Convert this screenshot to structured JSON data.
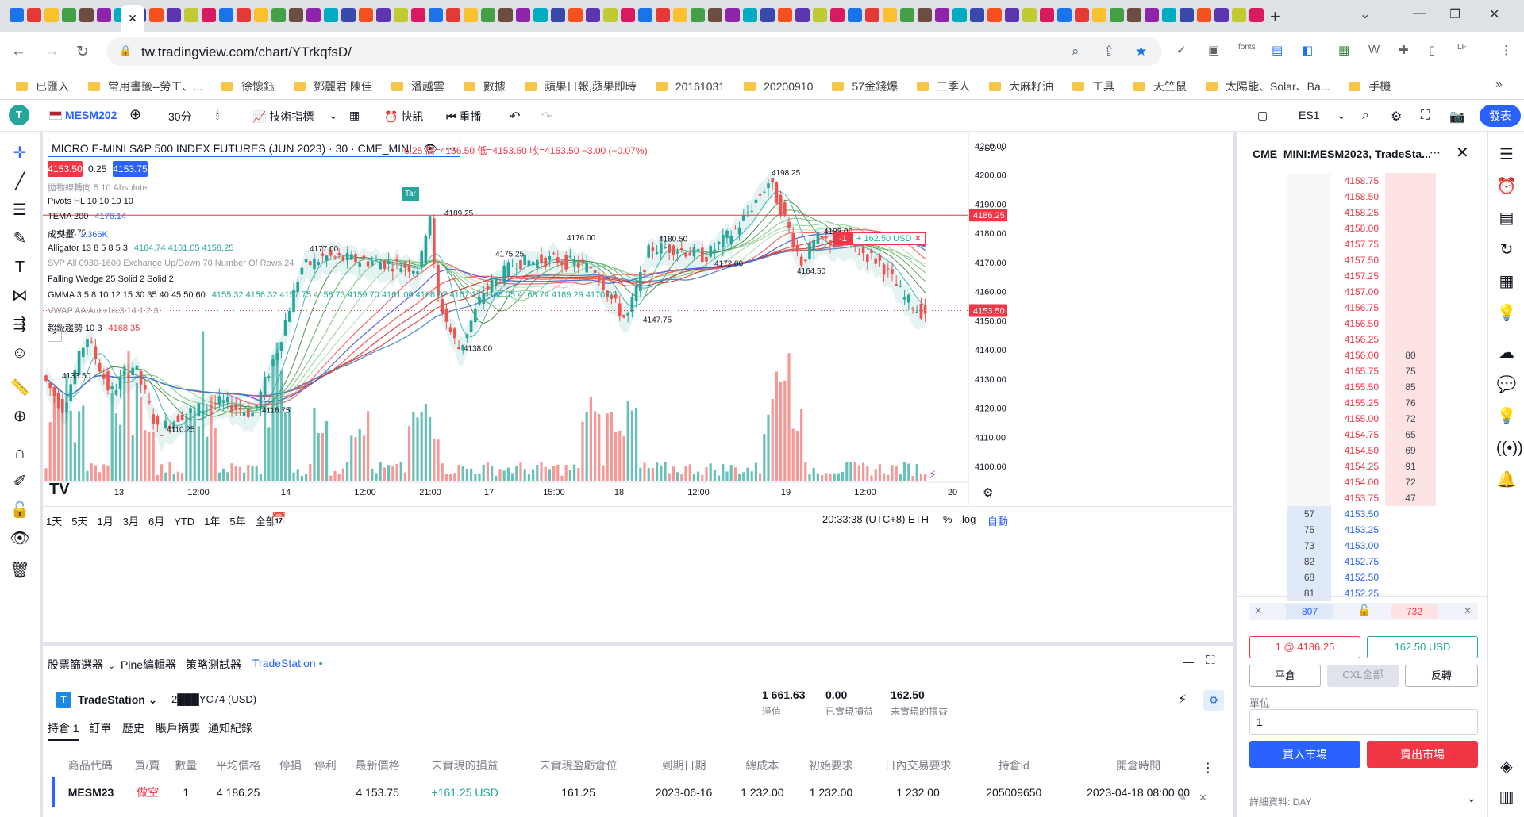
{
  "browser": {
    "url": "tw.tradingview.com/chart/YTrkqfsD/",
    "bookmarks": [
      "已匯入",
      "常用書籤--勞工、...",
      "徐懷鈺",
      "鄧麗君 陳佳",
      "潘越雲",
      "數據",
      "蘋果日報,蘋果即時",
      "20161031",
      "20200910",
      "57金錢爆",
      "三季人",
      "大麻籽油",
      "工具",
      "天竺鼠",
      "太陽能、Solar、Ba...",
      "手機"
    ]
  },
  "toolbar": {
    "symbol": "MESM202",
    "interval": "30分",
    "indicators": "技術指標",
    "alert": "快訊",
    "replay": "重播",
    "layout_name": "ES1",
    "publish": "發表"
  },
  "chart": {
    "legend_title": "MICRO E-MINI S&P 500 INDEX FUTURES (JUN 2023) · 30 · CME_MINI",
    "ohlc": "6.25 高=4156.50 低=4153.50 收=4153.50 −3.00 (−0.07%)",
    "bid_box": "4153.50",
    "spread": "0.25",
    "ask_box": "4153.75",
    "indicators": [
      {
        "name": "拋物線轉向 5 10 Absolute",
        "value": "",
        "muted": true
      },
      {
        "name": "Pivots HL 10 10 10 10",
        "value": ""
      },
      {
        "name": "TEMA 200",
        "value": "4176.14"
      },
      {
        "name": "成交量",
        "value": "1.366K"
      },
      {
        "name": "Alligator 13 8 5 8 5 3",
        "value": "4164.74  4161.05  4158.25"
      },
      {
        "name": "SVP All 0930-1600 Exchange Up/Down 70 Number Of Rows 24",
        "value": "",
        "muted": true
      },
      {
        "name": "Falling Wedge 25 Solid 2 Solid 2",
        "value": ""
      },
      {
        "name": "GMMA 3 5 8 10 12 15 30 35 40 45 50 60",
        "value": "4155.32 4156.32 4157.75 4158.73 4159.70 4161.06 4166.07 4167.17 4168.05 4168.74 4169.29 4170.02"
      },
      {
        "name": "VWAP AA Auto hlc3 14 1 2 3",
        "value": "",
        "muted": true
      },
      {
        "name": "超級趨勢 10 3",
        "value": "4168.35"
      }
    ],
    "currency": "USD",
    "price_axis": [
      "4210.00",
      "4200.00",
      "4190.00",
      "4180.00",
      "4170.00",
      "4160.00",
      "4150.00",
      "4140.00",
      "4130.00",
      "4120.00",
      "4110.00",
      "4100.00"
    ],
    "price_axis_values": [
      4210,
      4200,
      4190,
      4180,
      4170,
      4160,
      4150,
      4140,
      4130,
      4120,
      4110,
      4100
    ],
    "position_price_label": "4186.25",
    "position_price": 4186.25,
    "last_price_label": "4153.50",
    "last_price": 4153.5,
    "position_qty": "-1",
    "position_pnl": "+ 162.50 USD",
    "time_axis": [
      "13",
      "12:00",
      "14",
      "12:00",
      "21:00",
      "17",
      "15:00",
      "18",
      "12:00",
      "19",
      "12:00",
      "20"
    ],
    "pivot_labels": [
      {
        "text": "4177.75",
        "price": 4177.75
      },
      {
        "text": "4133.50",
        "price": 4133.5
      },
      {
        "text": "4110.25",
        "price": 4110.25
      },
      {
        "text": "4177.00",
        "price": 4177.0
      },
      {
        "text": "4116.75",
        "price": 4116.75
      },
      {
        "text": "4189.25",
        "price": 4189.25
      },
      {
        "text": "4138.00",
        "price": 4138.0
      },
      {
        "text": "4175.25",
        "price": 4175.25
      },
      {
        "text": "4176.00",
        "price": 4176.0
      },
      {
        "text": "4180.50",
        "price": 4180.5
      },
      {
        "text": "4147.75",
        "price": 4147.75
      },
      {
        "text": "4172.00",
        "price": 4172.0
      },
      {
        "text": "4198.25",
        "price": 4198.25
      },
      {
        "text": "4183.00",
        "price": 4183.0
      },
      {
        "text": "4164.50",
        "price": 4164.5
      }
    ],
    "ranges": [
      "1天",
      "5天",
      "1月",
      "3月",
      "6月",
      "YTD",
      "1年",
      "5年",
      "全部"
    ],
    "clock": "20:33:38 (UTC+8)",
    "session": "ETH",
    "pct": "%",
    "log": "log",
    "auto": "自動",
    "tag": "Tar"
  },
  "bottom": {
    "tabs": [
      "股票篩選器",
      "Pine編輯器",
      "策略測試器",
      "TradeStation"
    ],
    "broker": "TradeStation",
    "account": "2███YC74 (USD)",
    "stats": [
      {
        "value": "1 661.63",
        "label": "淨值"
      },
      {
        "value": "0.00",
        "label": "已實現損益"
      },
      {
        "value": "162.50",
        "label": "未實現的損益"
      }
    ],
    "subtabs": [
      "持倉 1",
      "訂單",
      "歷史",
      "賬戶摘要",
      "通知紀錄"
    ],
    "columns": [
      "商品代碼",
      "買/賣",
      "數量",
      "平均價格",
      "停損",
      "停利",
      "最新價格",
      "未實現的損益",
      "未實現盈虧倉位",
      "到期日期",
      "總成本",
      "初始要求",
      "日內交易要求",
      "持倉id",
      "開倉時間"
    ],
    "row": [
      "MESM23",
      "做空",
      "1",
      "4 186.25",
      "",
      "",
      "4 153.75",
      "+161.25 USD",
      "161.25",
      "2023-06-16",
      "1 232.00",
      "1 232.00",
      "1 232.00",
      "205009650",
      "2023-04-18 08:00:00"
    ]
  },
  "dom": {
    "title": "CME_MINI:MESM2023, TradeSta...",
    "ladder": [
      {
        "price": "4158.75",
        "bid": "",
        "ask": ""
      },
      {
        "price": "4158.50",
        "bid": "",
        "ask": ""
      },
      {
        "price": "4158.25",
        "bid": "",
        "ask": ""
      },
      {
        "price": "4158.00",
        "bid": "",
        "ask": ""
      },
      {
        "price": "4157.75",
        "bid": "",
        "ask": ""
      },
      {
        "price": "4157.50",
        "bid": "",
        "ask": ""
      },
      {
        "price": "4157.25",
        "bid": "",
        "ask": ""
      },
      {
        "price": "4157.00",
        "bid": "",
        "ask": ""
      },
      {
        "price": "4156.75",
        "bid": "",
        "ask": ""
      },
      {
        "price": "4156.50",
        "bid": "",
        "ask": ""
      },
      {
        "price": "4156.25",
        "bid": "",
        "ask": ""
      },
      {
        "price": "4156.00",
        "bid": "",
        "ask": "80"
      },
      {
        "price": "4155.75",
        "bid": "",
        "ask": "75"
      },
      {
        "price": "4155.50",
        "bid": "",
        "ask": "85"
      },
      {
        "price": "4155.25",
        "bid": "",
        "ask": "76"
      },
      {
        "price": "4155.00",
        "bid": "",
        "ask": "72"
      },
      {
        "price": "4154.75",
        "bid": "",
        "ask": "65"
      },
      {
        "price": "4154.50",
        "bid": "",
        "ask": "69"
      },
      {
        "price": "4154.25",
        "bid": "",
        "ask": "91"
      },
      {
        "price": "4154.00",
        "bid": "",
        "ask": "72"
      },
      {
        "price": "4153.75",
        "bid": "",
        "ask": "47"
      },
      {
        "price": "4153.50",
        "bid": "57",
        "ask": ""
      },
      {
        "price": "4153.25",
        "bid": "75",
        "ask": ""
      },
      {
        "price": "4153.00",
        "bid": "73",
        "ask": ""
      },
      {
        "price": "4152.75",
        "bid": "82",
        "ask": ""
      },
      {
        "price": "4152.50",
        "bid": "68",
        "ask": ""
      },
      {
        "price": "4152.25",
        "bid": "81",
        "ask": ""
      }
    ],
    "bid_total": "807",
    "ask_total": "732",
    "position_btn": "1 @ 4186.25",
    "pnl_btn": "162.50 USD",
    "flatten": "平倉",
    "cxl_all": "CXL全部",
    "reverse": "反轉",
    "units_label": "單位",
    "units_value": "1",
    "buy_market": "買入市場",
    "sell_market": "賣出市場",
    "details": "詳細資料: DAY"
  },
  "colors": {
    "up": "#26a69a",
    "down": "#ef5350",
    "brand": "#2962ff",
    "buy": "#2962ff",
    "sell": "#f23645"
  }
}
